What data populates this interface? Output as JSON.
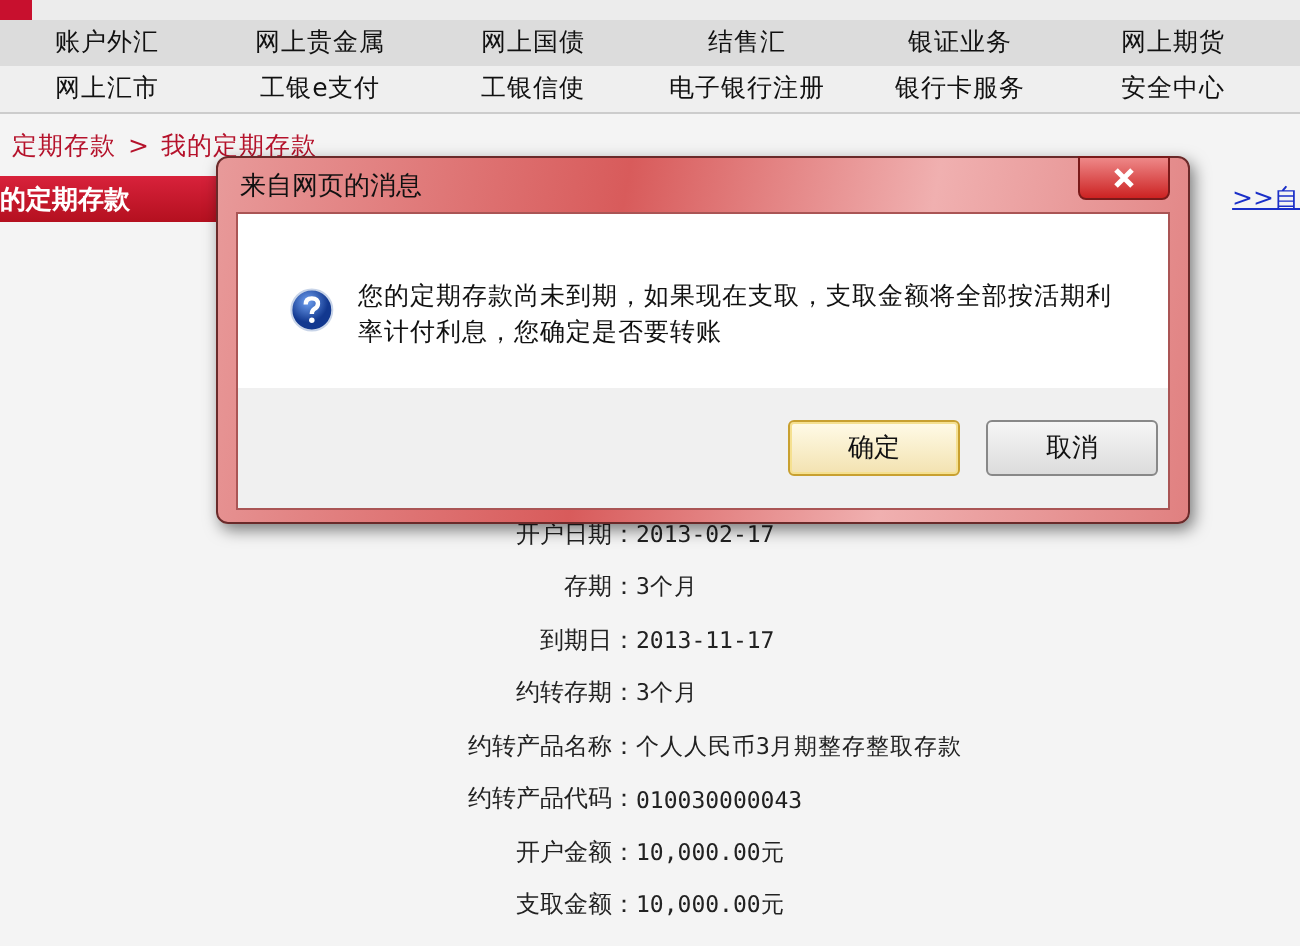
{
  "nav_rows": [
    [
      "账户外汇",
      "网上贵金属",
      "网上国债",
      "结售汇",
      "银证业务",
      "网上期货"
    ],
    [
      "网上汇市",
      "工银e支付",
      "工银信使",
      "电子银行注册",
      "银行卡服务",
      "安全中心"
    ]
  ],
  "breadcrumb": [
    {
      "label": "定期存款"
    },
    {
      "label": "我的定期存款"
    }
  ],
  "breadcrumb_separator": ">",
  "section_title": "的定期存款",
  "right_link": ">>自",
  "details": [
    {
      "label": "开户日期：",
      "value": "2013-02-17"
    },
    {
      "label": "存期：",
      "value": "3个月"
    },
    {
      "label": "到期日：",
      "value": "2013-11-17"
    },
    {
      "label": "约转存期：",
      "value": "3个月"
    },
    {
      "label": "约转产品名称：",
      "value": "个人人民币3月期整存整取存款"
    },
    {
      "label": "约转产品代码：",
      "value": "010030000043"
    },
    {
      "label": "开户金额：",
      "value": "10,000.00元"
    },
    {
      "label": "支取金额：",
      "value": "10,000.00元"
    }
  ],
  "dialog": {
    "title": "来自网页的消息",
    "message": "您的定期存款尚未到期，如果现在支取，支取金额将全部按活期利率计付利息，您确定是否要转账",
    "buttons": [
      {
        "label": "确定",
        "selected": true
      },
      {
        "label": "取消",
        "selected": false
      }
    ]
  }
}
